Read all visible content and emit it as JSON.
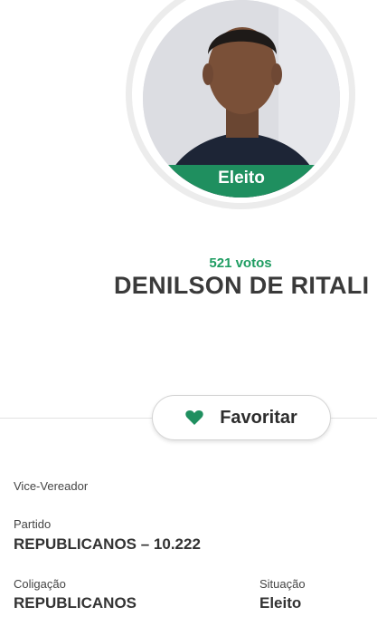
{
  "candidate": {
    "status_banner": "Eleito",
    "votes": "521 votos",
    "name": "DENILSON DE RITALI"
  },
  "actions": {
    "favorite_label": "Favoritar",
    "favorite_icon": "heart-icon",
    "accent_color": "#1f8f5f"
  },
  "details": {
    "role": "Vice-Vereador",
    "party_label": "Partido",
    "party_value": "REPUBLICANOS – 10.222",
    "coalition_label": "Coligação",
    "coalition_value": "REPUBLICANOS",
    "situation_label": "Situação",
    "situation_value": "Eleito"
  }
}
